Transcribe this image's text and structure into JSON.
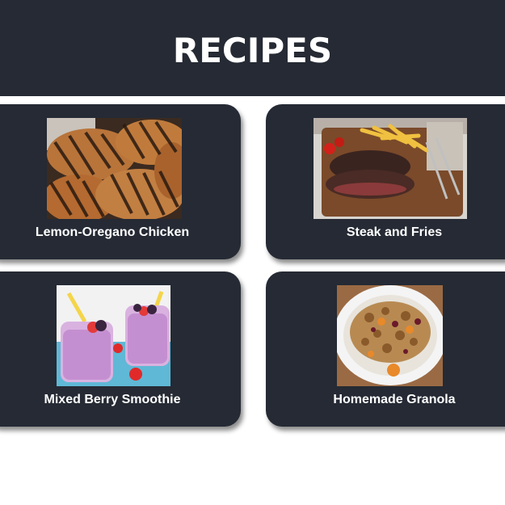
{
  "header": {
    "title": "RECIPES"
  },
  "recipes": [
    {
      "name": "Lemon-Oregano Chicken",
      "image_icon": "grilled-chicken-photo"
    },
    {
      "name": "Steak and Fries",
      "image_icon": "steak-fries-photo"
    },
    {
      "name": "Mixed Berry Smoothie",
      "image_icon": "berry-smoothie-photo"
    },
    {
      "name": "Homemade Granola",
      "image_icon": "granola-bowl-photo"
    }
  ],
  "colors": {
    "header_bg": "#252a34",
    "card_bg": "#252a34",
    "text": "#ffffff",
    "page_bg": "#ffffff"
  }
}
